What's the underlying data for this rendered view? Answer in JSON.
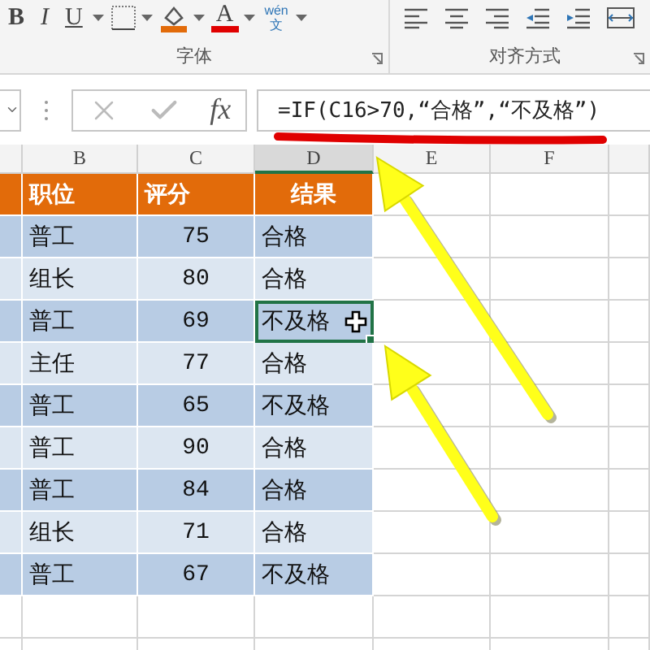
{
  "ribbon": {
    "font_group": {
      "label": "字体",
      "buttons": [
        {
          "kind": "bold",
          "text": "B"
        },
        {
          "kind": "italic",
          "text": "I"
        },
        {
          "kind": "underline",
          "text": "U"
        },
        {
          "kind": "borders"
        },
        {
          "kind": "fill_color"
        },
        {
          "kind": "font_color",
          "text": "A"
        },
        {
          "kind": "phonetic",
          "text": "wén",
          "sub": "文"
        }
      ]
    },
    "alignment_group": {
      "label": "对齐方式",
      "buttons": [
        {
          "kind": "align_left"
        },
        {
          "kind": "align_center"
        },
        {
          "kind": "align_right"
        },
        {
          "kind": "indent_decrease"
        },
        {
          "kind": "indent_increase"
        },
        {
          "kind": "merge"
        }
      ]
    }
  },
  "formula_bar": {
    "fx": "fx",
    "formula": "=IF(C16>70,“合格”,“不及格”)"
  },
  "sheet": {
    "columns": [
      {
        "label": "B",
        "selected": false
      },
      {
        "label": "C",
        "selected": false
      },
      {
        "label": "D",
        "selected": true
      },
      {
        "label": "E",
        "selected": false
      },
      {
        "label": "F",
        "selected": false
      }
    ],
    "header": [
      "职位",
      "评分",
      "结果"
    ],
    "rows": [
      {
        "cells": [
          "普工",
          "75",
          "合格"
        ],
        "selected": false
      },
      {
        "cells": [
          "组长",
          "80",
          "合格"
        ],
        "selected": false
      },
      {
        "cells": [
          "普工",
          "69",
          "不及格"
        ],
        "selected": true
      },
      {
        "cells": [
          "主任",
          "77",
          "合格"
        ],
        "selected": false
      },
      {
        "cells": [
          "普工",
          "65",
          "不及格"
        ],
        "selected": false
      },
      {
        "cells": [
          "普工",
          "90",
          "合格"
        ],
        "selected": false
      },
      {
        "cells": [
          "普工",
          "84",
          "合格"
        ],
        "selected": false
      },
      {
        "cells": [
          "组长",
          "71",
          "合格"
        ],
        "selected": false
      },
      {
        "cells": [
          "普工",
          "67",
          "不及格"
        ],
        "selected": false
      }
    ]
  }
}
